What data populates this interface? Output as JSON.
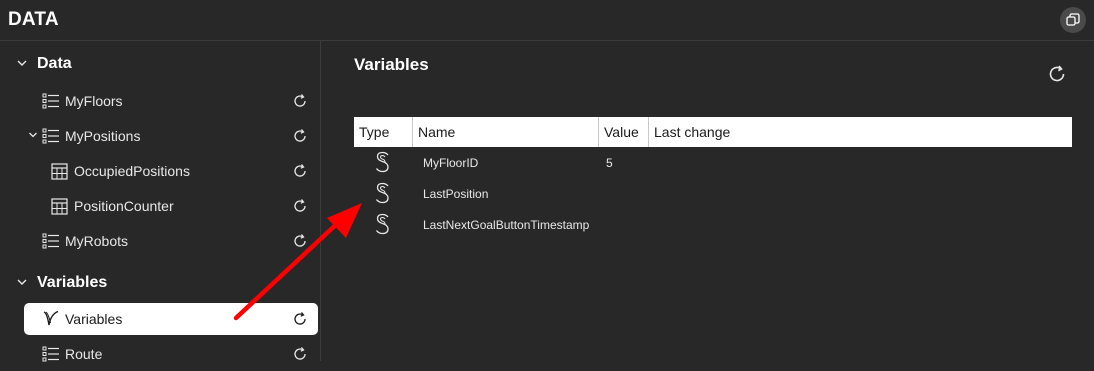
{
  "app": {
    "title": "DATA"
  },
  "sidebar": {
    "sections": [
      {
        "label": "Data"
      },
      {
        "label": "Variables"
      }
    ],
    "items": [
      {
        "label": "MyFloors",
        "icon": "list-icon"
      },
      {
        "label": "MyPositions",
        "icon": "list-icon"
      },
      {
        "label": "OccupiedPositions",
        "icon": "table-icon"
      },
      {
        "label": "PositionCounter",
        "icon": "table-icon"
      },
      {
        "label": "MyRobots",
        "icon": "list-icon"
      },
      {
        "label": "Variables",
        "icon": "variables-icon"
      },
      {
        "label": "Route",
        "icon": "list-icon"
      }
    ]
  },
  "main": {
    "title": "Variables",
    "table": {
      "columns": [
        "Type",
        "Name",
        "Value",
        "Last change"
      ],
      "rows": [
        {
          "type_icon": "string-icon",
          "name": "MyFloorID",
          "value": "5",
          "last_change": ""
        },
        {
          "type_icon": "string-icon",
          "name": "LastPosition",
          "value": "",
          "last_change": ""
        },
        {
          "type_icon": "string-icon",
          "name": "LastNextGoalButtonTimestamp",
          "value": "",
          "last_change": ""
        }
      ]
    }
  },
  "annotation": {
    "arrow_color": "#ff0000"
  },
  "colors": {
    "background": "#282828",
    "selected": "#ffffff"
  }
}
